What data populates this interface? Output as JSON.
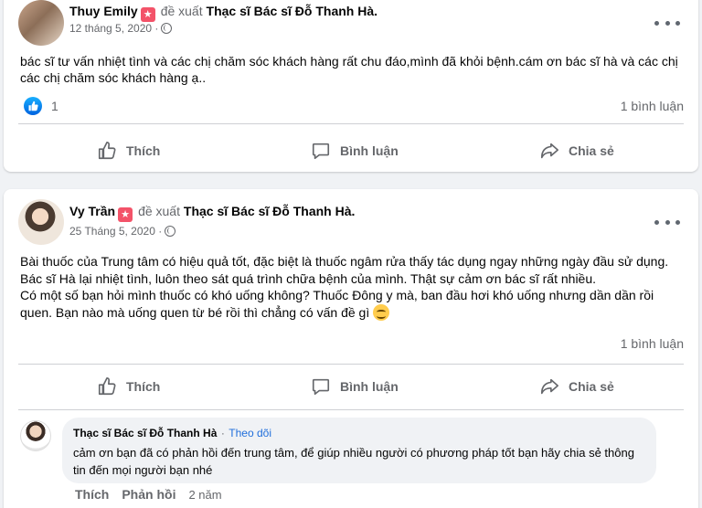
{
  "posts": [
    {
      "author": "Thuy Emily",
      "badge": "★",
      "verb": "đề xuất",
      "page": "Thạc sĩ Bác sĩ Đỗ Thanh Hà.",
      "date": "12 tháng 5, 2020 ·",
      "text": "bác sĩ tư vấn nhiệt tình và các chị chăm sóc khách hàng rất chu đáo,mình đã khỏi bệnh.cám ơn bác sĩ hà và các chị các chị chăm sóc khách hàng ạ..",
      "like_count": "1",
      "comment_count": "1 bình luận"
    },
    {
      "author": "Vy Trần",
      "badge": "★",
      "verb": "đề xuất",
      "page": "Thạc sĩ Bác sĩ Đỗ Thanh Hà.",
      "date": "25 Tháng 5, 2020 ·",
      "lines": [
        "Bài thuốc của Trung tâm có hiệu quả tốt, đặc biệt là thuốc ngâm rửa thấy tác dụng ngay những ngày đầu sử dụng.",
        "Bác sĩ Hà lại nhiệt tình, luôn theo sát quá trình chữa bệnh của mình. Thật sự cảm ơn bác sĩ rất nhiều.",
        "Có một số bạn hỏi mình thuốc có khó uống không? Thuốc Đông y mà, ban đầu hơi khó uống nhưng dần dần rồi quen. Bạn nào mà uống quen từ bé rồi thì chẳng có vấn đề gì"
      ],
      "comment_count": "1 bình luận"
    }
  ],
  "actions": {
    "like": "Thích",
    "comment": "Bình luận",
    "share": "Chia sẻ"
  },
  "comment": {
    "author": "Thạc sĩ Bác sĩ Đỗ Thanh Hà",
    "separator": "·",
    "follow": "Theo dõi",
    "text": "cảm ơn bạn đã có phản hồi đến trung tâm, để giúp nhiều người có phương pháp tốt bạn hãy chia sẻ thông tin đến mọi người bạn nhé",
    "like": "Thích",
    "reply": "Phản hồi",
    "time": "2 năm"
  },
  "colors": {
    "background": "#f0f2f5",
    "link_blue": "#216fdb",
    "like_blue": "#1877f2",
    "secondary_text": "#65676b",
    "recommend_badge": "#f35369"
  },
  "icons": [
    "globe-icon",
    "more-icon",
    "like-reaction-icon",
    "thumbs-up-icon",
    "comment-icon",
    "share-icon",
    "smile-emoji-icon"
  ]
}
